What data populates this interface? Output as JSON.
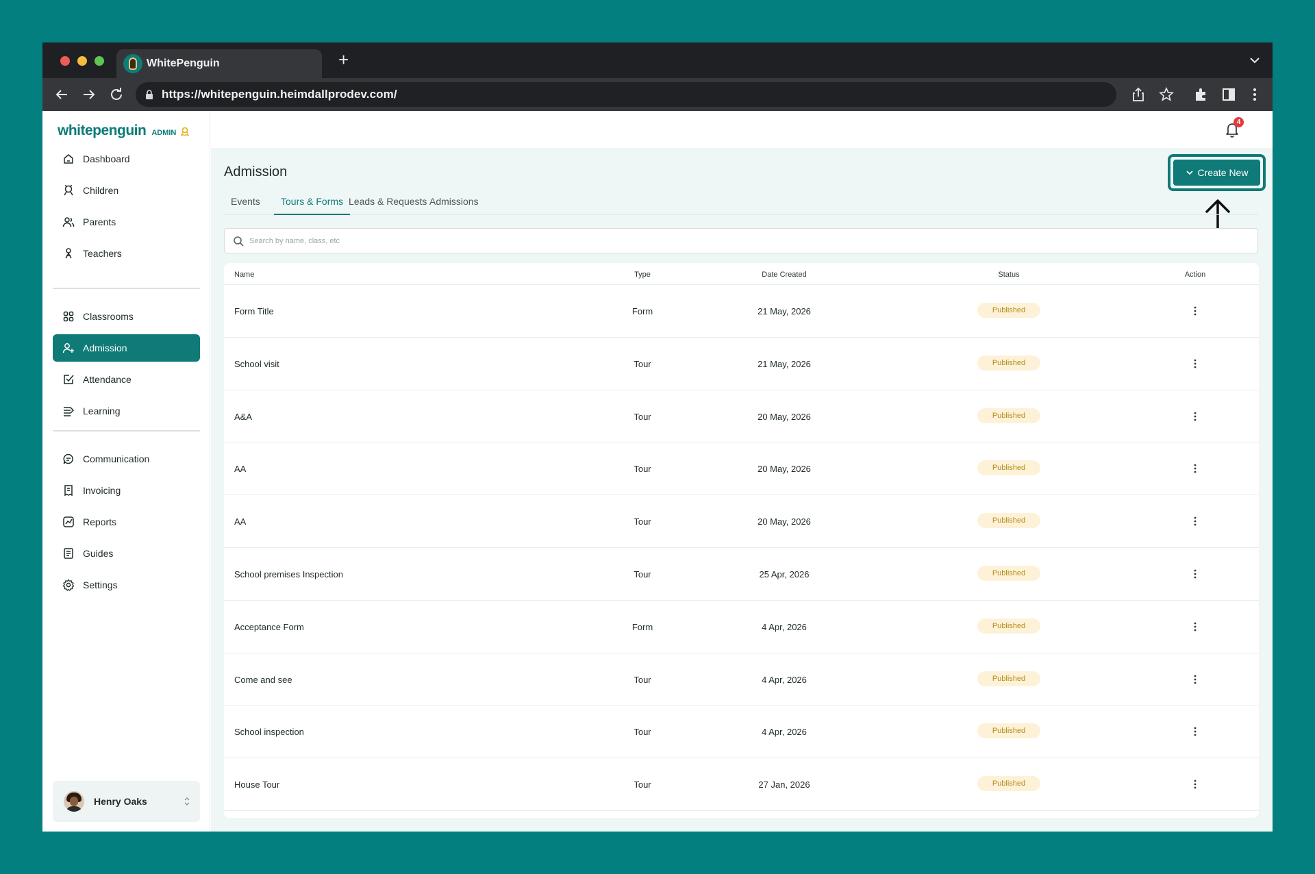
{
  "browser": {
    "tab_title": "WhitePenguin",
    "url": "https://whitepenguin.heimdallprodev.com/"
  },
  "brand": {
    "name": "whitepenguin",
    "badge": "ADMIN",
    "accent": "#0f7a77"
  },
  "sidebar": {
    "items": [
      {
        "label": "Dashboard",
        "icon": "home-icon"
      },
      {
        "label": "Children",
        "icon": "child-icon"
      },
      {
        "label": "Parents",
        "icon": "parents-icon"
      },
      {
        "label": "Teachers",
        "icon": "teacher-icon"
      },
      {
        "label": "Classrooms",
        "icon": "grid-icon"
      },
      {
        "label": "Admission",
        "icon": "user-add-icon",
        "active": true
      },
      {
        "label": "Attendance",
        "icon": "checkbox-icon"
      },
      {
        "label": "Learning",
        "icon": "learning-icon"
      },
      {
        "label": "Communication",
        "icon": "chat-icon"
      },
      {
        "label": "Invoicing",
        "icon": "invoice-icon"
      },
      {
        "label": "Reports",
        "icon": "chart-icon"
      },
      {
        "label": "Guides",
        "icon": "book-icon"
      },
      {
        "label": "Settings",
        "icon": "gear-icon"
      }
    ],
    "user": {
      "name": "Henry Oaks"
    }
  },
  "header": {
    "notifications": "4"
  },
  "page": {
    "title": "Admission",
    "create_label": "Create New",
    "tabs": [
      {
        "label": "Events"
      },
      {
        "label": "Tours & Forms",
        "active": true
      },
      {
        "label": "Leads & Requests"
      },
      {
        "label": "Admissions"
      }
    ],
    "search_placeholder": "Search by name, class, etc"
  },
  "table": {
    "headers": {
      "name": "Name",
      "type": "Type",
      "date": "Date Created",
      "status": "Status",
      "action": "Action"
    },
    "rows": [
      {
        "name": "Form Title",
        "type": "Form",
        "date": "21 May, 2026",
        "status": "Published"
      },
      {
        "name": "School visit",
        "type": "Tour",
        "date": "21 May, 2026",
        "status": "Published"
      },
      {
        "name": "A&A",
        "type": "Tour",
        "date": "20 May, 2026",
        "status": "Published"
      },
      {
        "name": "AA",
        "type": "Tour",
        "date": "20 May, 2026",
        "status": "Published"
      },
      {
        "name": "AA",
        "type": "Tour",
        "date": "20 May, 2026",
        "status": "Published"
      },
      {
        "name": "School premises Inspection",
        "type": "Tour",
        "date": "25 Apr, 2026",
        "status": "Published"
      },
      {
        "name": "Acceptance Form",
        "type": "Form",
        "date": "4 Apr, 2026",
        "status": "Published"
      },
      {
        "name": "Come and see",
        "type": "Tour",
        "date": "4 Apr, 2026",
        "status": "Published"
      },
      {
        "name": "School inspection",
        "type": "Tour",
        "date": "4 Apr, 2026",
        "status": "Published"
      },
      {
        "name": "House Tour",
        "type": "Tour",
        "date": "27 Jan, 2026",
        "status": "Published"
      }
    ]
  }
}
